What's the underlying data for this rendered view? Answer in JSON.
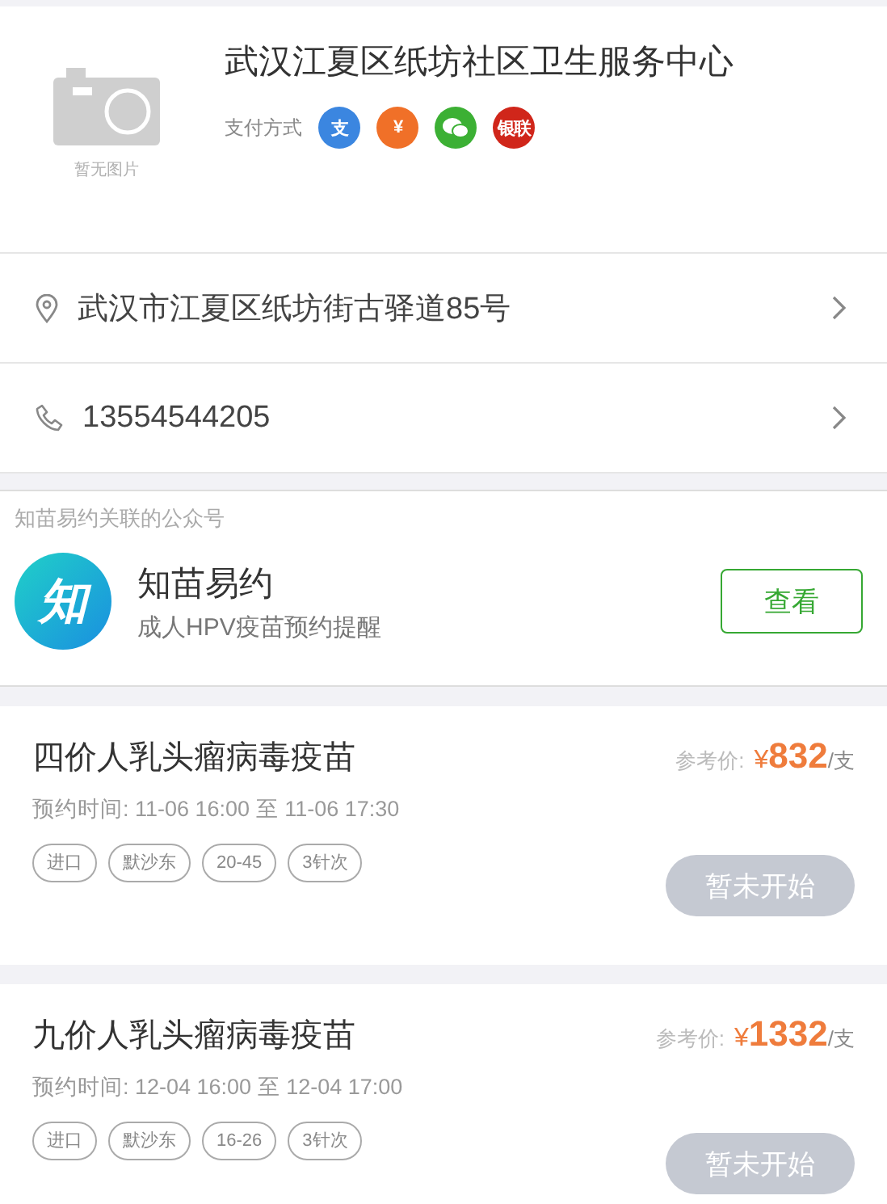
{
  "clinic": {
    "name": "武汉江夏区纸坊社区卫生服务中心",
    "no_image_text": "暂无图片",
    "payment_label": "支付方式",
    "payments": [
      {
        "glyph": "支",
        "color": "#3b86e0"
      },
      {
        "glyph": "¥",
        "color": "#f07028"
      },
      {
        "color": "#3cb034"
      },
      {
        "glyph": "银联",
        "color": "#d0261a"
      }
    ]
  },
  "contact_rows": [
    {
      "kind": "address",
      "text": "武汉市江夏区纸坊街古驿道85号"
    },
    {
      "kind": "phone",
      "text": "13554544205"
    }
  ],
  "official_account": {
    "heading": "知苗易约关联的公众号",
    "logo_glyph": "知",
    "name": "知苗易约",
    "description": "成人HPV疫苗预约提醒",
    "button": "查看"
  },
  "vaccines": [
    {
      "name": "四价人乳头瘤病毒疫苗",
      "price_label": "参考价:",
      "currency": "¥",
      "price": "832",
      "unit": "/支",
      "time": "预约时间:  11-06 16:00 至 11-06 17:30",
      "tags": [
        "进口",
        "默沙东",
        "20-45",
        "3针次"
      ],
      "button": "暂未开始",
      "disabled": true
    },
    {
      "name": "九价人乳头瘤病毒疫苗",
      "price_label": "参考价:",
      "currency": "¥",
      "price": "1332",
      "unit": "/支",
      "time": "预约时间:  12-04 16:00 至 12-04 17:00",
      "tags": [
        "进口",
        "默沙东",
        "16-26",
        "3针次"
      ],
      "button": "暂未开始",
      "disabled": true
    }
  ]
}
